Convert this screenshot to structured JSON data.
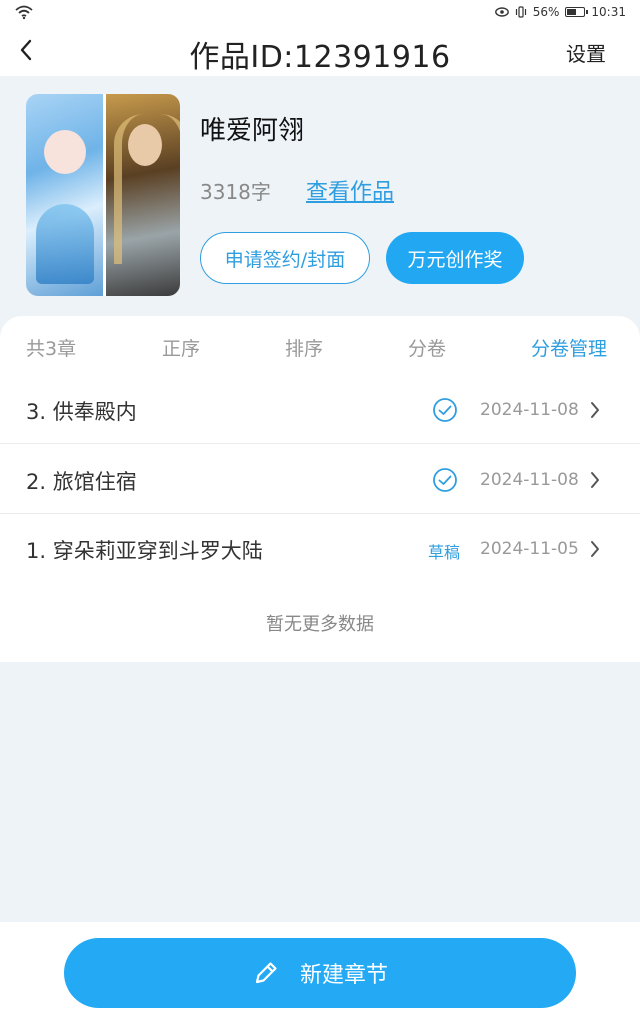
{
  "status_bar": {
    "battery": "56%",
    "time": "10:31"
  },
  "nav": {
    "title": "作品ID:12391916",
    "settings_label": "设置"
  },
  "work": {
    "name": "唯爱阿翎",
    "word_count": "3318字",
    "view_link": "查看作品",
    "sign_button": "申请签约/封面",
    "award_button": "万元创作奖"
  },
  "tabs": {
    "count": "共3章",
    "ascending": "正序",
    "sort": "排序",
    "volume": "分卷",
    "volume_manage": "分卷管理"
  },
  "chapters": [
    {
      "title": "3. 供奉殿内",
      "status": "published",
      "date": "2024-11-08"
    },
    {
      "title": "2. 旅馆住宿",
      "status": "published",
      "date": "2024-11-08"
    },
    {
      "title": "1. 穿朵莉亚穿到斗罗大陆",
      "status": "draft",
      "status_label": "草稿",
      "date": "2024-11-05"
    }
  ],
  "no_more_text": "暂无更多数据",
  "new_chapter_button": "新建章节",
  "colors": {
    "accent": "#2f9ee0",
    "button": "#24aaf4",
    "background": "#eef3f8"
  }
}
